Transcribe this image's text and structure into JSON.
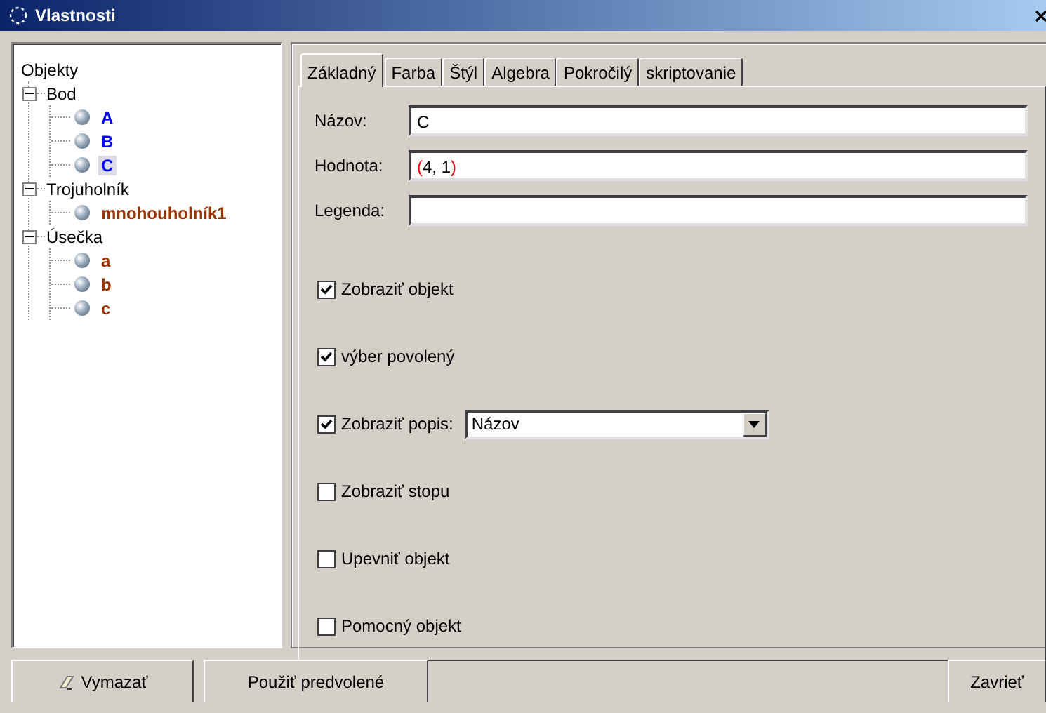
{
  "window": {
    "title": "Vlastnosti"
  },
  "tree": {
    "root": "Objekty",
    "children": [
      {
        "label": "Bod",
        "expanded": true,
        "children": [
          {
            "label": "A",
            "color": "#0000ff",
            "selected": false
          },
          {
            "label": "B",
            "color": "#0000ff",
            "selected": false
          },
          {
            "label": "C",
            "color": "#0000ff",
            "selected": true
          }
        ]
      },
      {
        "label": "Trojuholník",
        "expanded": true,
        "children": [
          {
            "label": "mnohouholník1",
            "color": "#993300",
            "selected": false
          }
        ]
      },
      {
        "label": "Úsečka",
        "expanded": true,
        "children": [
          {
            "label": "a",
            "color": "#993300",
            "selected": false
          },
          {
            "label": "b",
            "color": "#993300",
            "selected": false
          },
          {
            "label": "c",
            "color": "#993300",
            "selected": false
          }
        ]
      }
    ]
  },
  "tabs": [
    {
      "label": "Základný",
      "selected": true
    },
    {
      "label": "Farba",
      "selected": false
    },
    {
      "label": "Štýl",
      "selected": false
    },
    {
      "label": "Algebra",
      "selected": false
    },
    {
      "label": "Pokročilý",
      "selected": false
    },
    {
      "label": "skriptovanie",
      "selected": false
    }
  ],
  "fields": [
    {
      "label": "Názov:",
      "parts": [
        {
          "text": "C"
        }
      ]
    },
    {
      "label": "Hodnota:",
      "parts": [
        {
          "text": "(",
          "color": "#ff0000"
        },
        {
          "text": "4, 1"
        },
        {
          "text": ")",
          "color": "#ff0000"
        }
      ]
    },
    {
      "label": "Legenda:"
    }
  ],
  "options": [
    {
      "kind": "checkbox",
      "label": "Zobraziť objekt",
      "checked": true
    },
    {
      "kind": "checkbox",
      "label": "výber povolený",
      "checked": true
    },
    {
      "kind": "checkbox-dropdown",
      "label": "Zobraziť popis:",
      "checked": true,
      "dropdown": "Názov"
    },
    {
      "kind": "checkbox",
      "label": "Zobraziť stopu",
      "checked": false
    },
    {
      "kind": "checkbox",
      "label": "Upevniť objekt",
      "checked": false
    },
    {
      "kind": "checkbox",
      "label": "Pomocný objekt",
      "checked": false
    }
  ],
  "footer": {
    "left": [
      {
        "label": "Vymazať",
        "kind": "eraser"
      },
      {
        "label": "Použiť predvolené",
        "kind": "plain"
      }
    ],
    "right": [
      {
        "label": "Zavrieť",
        "kind": "plain"
      }
    ]
  }
}
